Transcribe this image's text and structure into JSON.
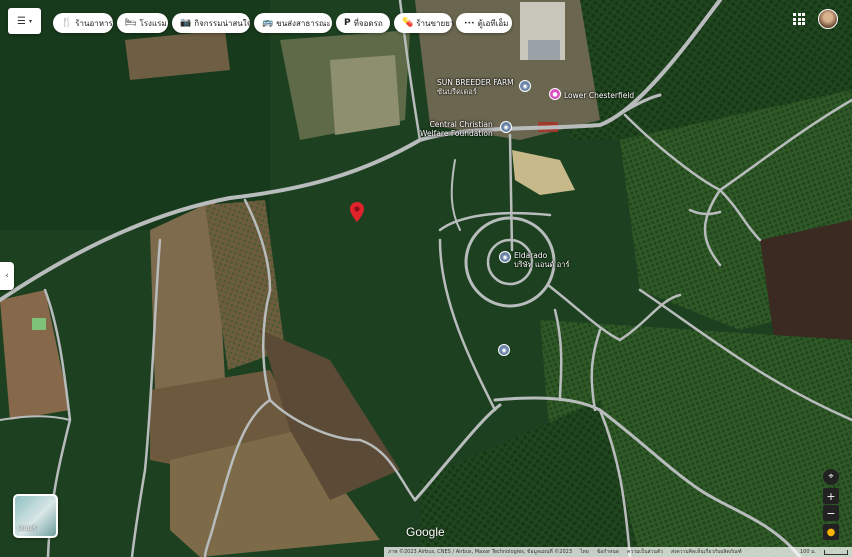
{
  "map": {
    "type": "satellite",
    "colors": {
      "forest_dark": "#13301a",
      "forest": "#1f4a22",
      "plantation": "#2d5a26",
      "field_brown": "#7a6448",
      "road": "#b9bcbc",
      "pin": "#e0232b"
    }
  },
  "toolbar": {
    "menu_icon": "hamburger-icon",
    "chips": [
      {
        "icon": "restaurant-icon",
        "glyph": "🍴",
        "label": "ร้านอาหาร"
      },
      {
        "icon": "hotel-icon",
        "glyph": "🛏",
        "label": "โรงแรม"
      },
      {
        "icon": "camera-icon",
        "glyph": "📷",
        "label": "กิจกรรมน่าสนใจ"
      },
      {
        "icon": "bus-icon",
        "glyph": "🚌",
        "label": "ขนส่งสาธารณะ"
      },
      {
        "icon": "parking-icon",
        "glyph": "P",
        "label": "ที่จอดรถ"
      },
      {
        "icon": "pharmacy-icon",
        "glyph": "💊",
        "label": "ร้านขายยา"
      },
      {
        "icon": "more-icon",
        "glyph": "•••",
        "label": "ตู้เอทีเอ็ม"
      }
    ]
  },
  "poi": [
    {
      "name": "SUN BREEDER FARM",
      "sub": "ซันบรีดเดอร์"
    },
    {
      "name": "Lower Chesterfield",
      "sub": ""
    },
    {
      "name": "Central Christian",
      "sub": "Welfare Foundation"
    },
    {
      "name": "Eldarado",
      "sub": "บริษัท แอนด์ อาร์"
    }
  ],
  "controls": {
    "layers_label": "เลเยอร์",
    "zoom_in": "+",
    "zoom_out": "−"
  },
  "footer": {
    "logo": "Google",
    "imagery": "ภาพ ©2023 Airbus, CNES / Airbus, Maxar Technologies, ข้อมูลแผนที่ ©2023",
    "links": [
      "ไทย",
      "ข้อกำหนด",
      "ความเป็นส่วนตัว",
      "ส่งความคิดเห็นเกี่ยวกับผลิตภัณฑ์"
    ],
    "scale": "100 ม."
  }
}
